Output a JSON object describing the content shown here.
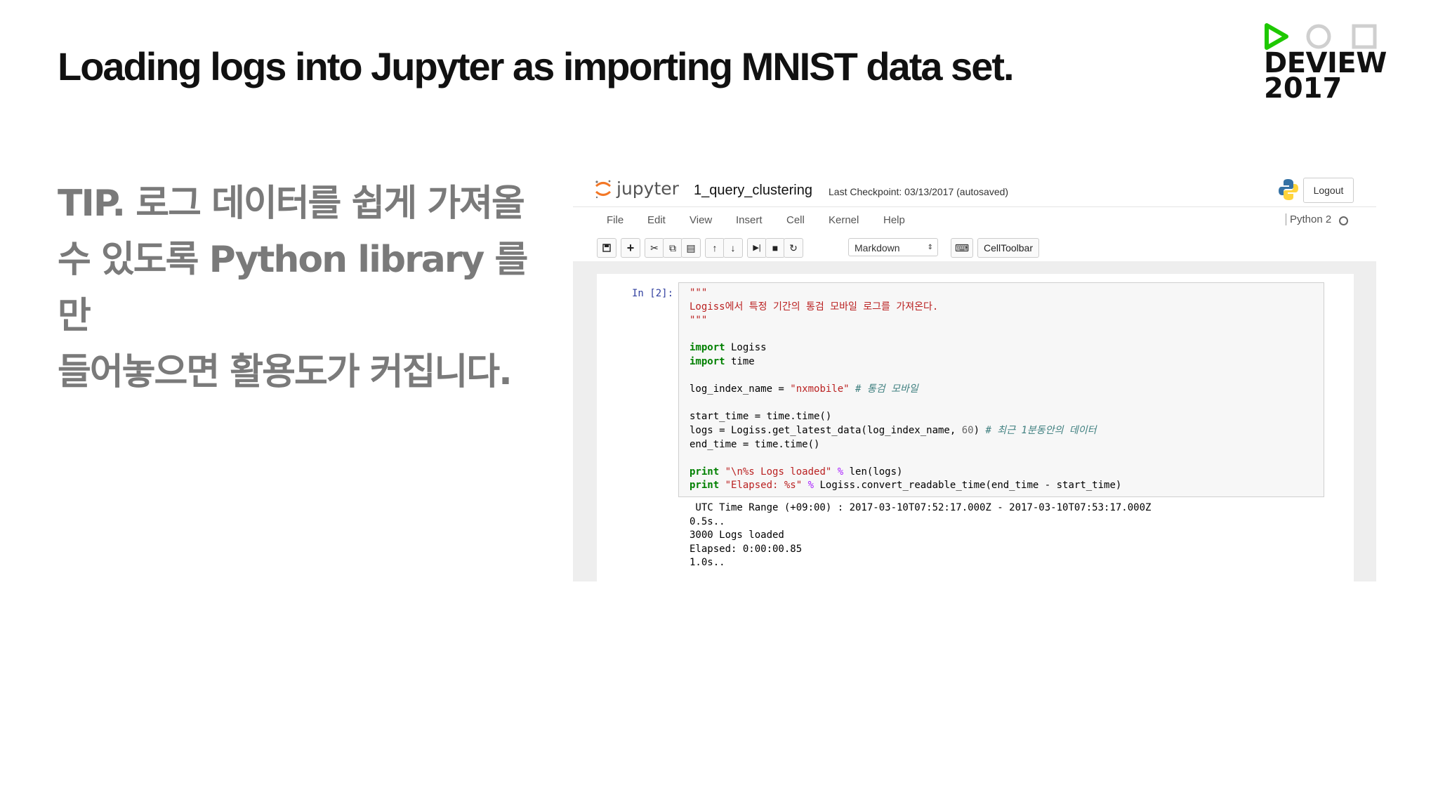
{
  "slide": {
    "title": "Loading logs into Jupyter as importing MNIST data set.",
    "tip_lines": [
      "TIP. 로그 데이터를 쉽게 가져올",
      "수 있도록 Python library 를 만",
      "들어놓으면 활용도가 커집니다."
    ]
  },
  "logo": {
    "word": "DEVIEW",
    "year": "2017",
    "accent_color": "#1ec800"
  },
  "jupyter": {
    "app_name": "jupyter",
    "notebook_title": "1_query_clustering",
    "checkpoint": "Last Checkpoint: 03/13/2017 (autosaved)",
    "logout_label": "Logout",
    "menu": [
      "File",
      "Edit",
      "View",
      "Insert",
      "Cell",
      "Kernel",
      "Help"
    ],
    "kernel": "Python 2",
    "cell_type": "Markdown",
    "celltoolbar_label": "CellToolbar",
    "prompt": "In [2]:",
    "code": {
      "doc_quote_open": "\"\"\"",
      "doc_text": "Logiss에서 특정 기간의 통검 모바일 로그를 가져온다.",
      "doc_quote_close": "\"\"\"",
      "import_kw1": "import",
      "import_mod1": " Logiss",
      "import_kw2": "import",
      "import_mod2": " time",
      "l_index_a": "log_index_name = ",
      "l_index_str": "\"nxmobile\"",
      "l_index_cm": " # 통검 모바일",
      "l_start": "start_time = time.time()",
      "l_logs_a": "logs = Logiss.get_latest_data(log_index_name, ",
      "l_logs_num": "60",
      "l_logs_b": ") ",
      "l_logs_cm": "# 최근 1분동안의 데이터",
      "l_end": "end_time = time.time()",
      "print_kw": "print",
      "p1_str": " \"\\n%s Logs loaded\"",
      "p1_op": " %",
      "p1_b": " len(logs)",
      "p2_str": " \"Elapsed: %s\"",
      "p2_op": " %",
      "p2_b": " Logiss.convert_readable_time(end_time - start_time)"
    },
    "output": " UTC Time Range (+09:00) : 2017-03-10T07:52:17.000Z - 2017-03-10T07:53:17.000Z\n0.5s..\n3000 Logs loaded\nElapsed: 0:00:00.85\n1.0s.."
  }
}
